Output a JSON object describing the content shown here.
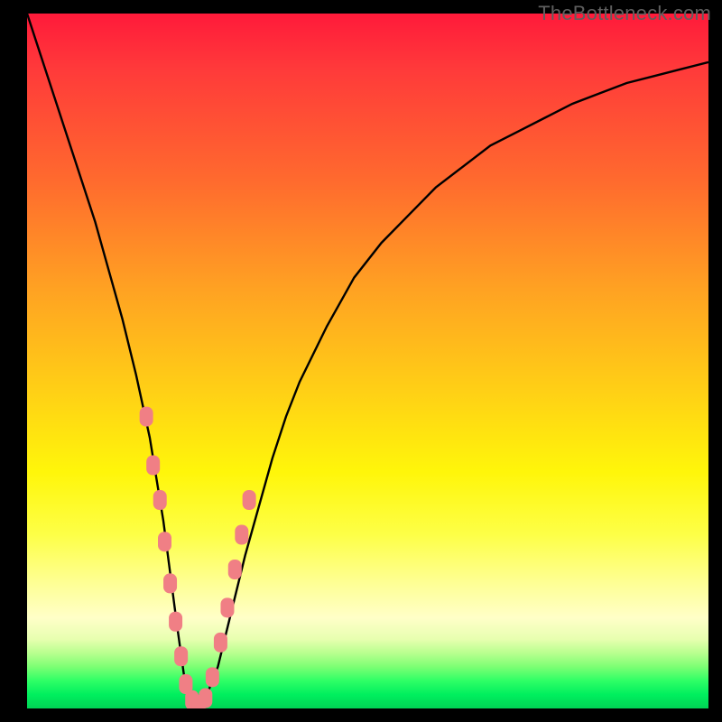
{
  "watermark": "TheBottleneck.com",
  "colors": {
    "curve_stroke": "#000000",
    "marker_fill": "#f07f85",
    "marker_stroke": "#f07f85",
    "frame_bg": "#000000"
  },
  "chart_data": {
    "type": "line",
    "title": "",
    "xlabel": "",
    "ylabel": "",
    "xlim": [
      0,
      100
    ],
    "ylim": [
      0,
      100
    ],
    "grid": false,
    "legend": false,
    "note": "Axis values are in percent of plotting area (0 left/bottom, 100 right/top). Curve y values estimated from gridless figure.",
    "series": [
      {
        "name": "bottleneck-curve",
        "x": [
          0,
          2,
          4,
          6,
          8,
          10,
          12,
          14,
          16,
          18,
          20,
          22,
          23,
          24,
          25,
          26,
          28,
          30,
          32,
          34,
          36,
          38,
          40,
          44,
          48,
          52,
          56,
          60,
          64,
          68,
          72,
          76,
          80,
          84,
          88,
          92,
          96,
          100
        ],
        "y": [
          100,
          94,
          88,
          82,
          76,
          70,
          63,
          56,
          48,
          39,
          27,
          12,
          5,
          1,
          0,
          1,
          6,
          14,
          22,
          29,
          36,
          42,
          47,
          55,
          62,
          67,
          71,
          75,
          78,
          81,
          83,
          85,
          87,
          88.5,
          90,
          91,
          92,
          93
        ]
      }
    ],
    "markers": {
      "name": "highlighted-points",
      "shape": "rounded-rect",
      "approx_size_px": 16,
      "points_xy": [
        [
          17.5,
          42
        ],
        [
          18.5,
          35
        ],
        [
          19.5,
          30
        ],
        [
          20.2,
          24
        ],
        [
          21.0,
          18
        ],
        [
          21.8,
          12.5
        ],
        [
          22.6,
          7.5
        ],
        [
          23.3,
          3.5
        ],
        [
          24.2,
          1.2
        ],
        [
          25.2,
          0.5
        ],
        [
          26.2,
          1.5
        ],
        [
          27.2,
          4.5
        ],
        [
          28.4,
          9.5
        ],
        [
          29.4,
          14.5
        ],
        [
          30.5,
          20
        ],
        [
          31.5,
          25
        ],
        [
          32.6,
          30
        ]
      ]
    }
  }
}
